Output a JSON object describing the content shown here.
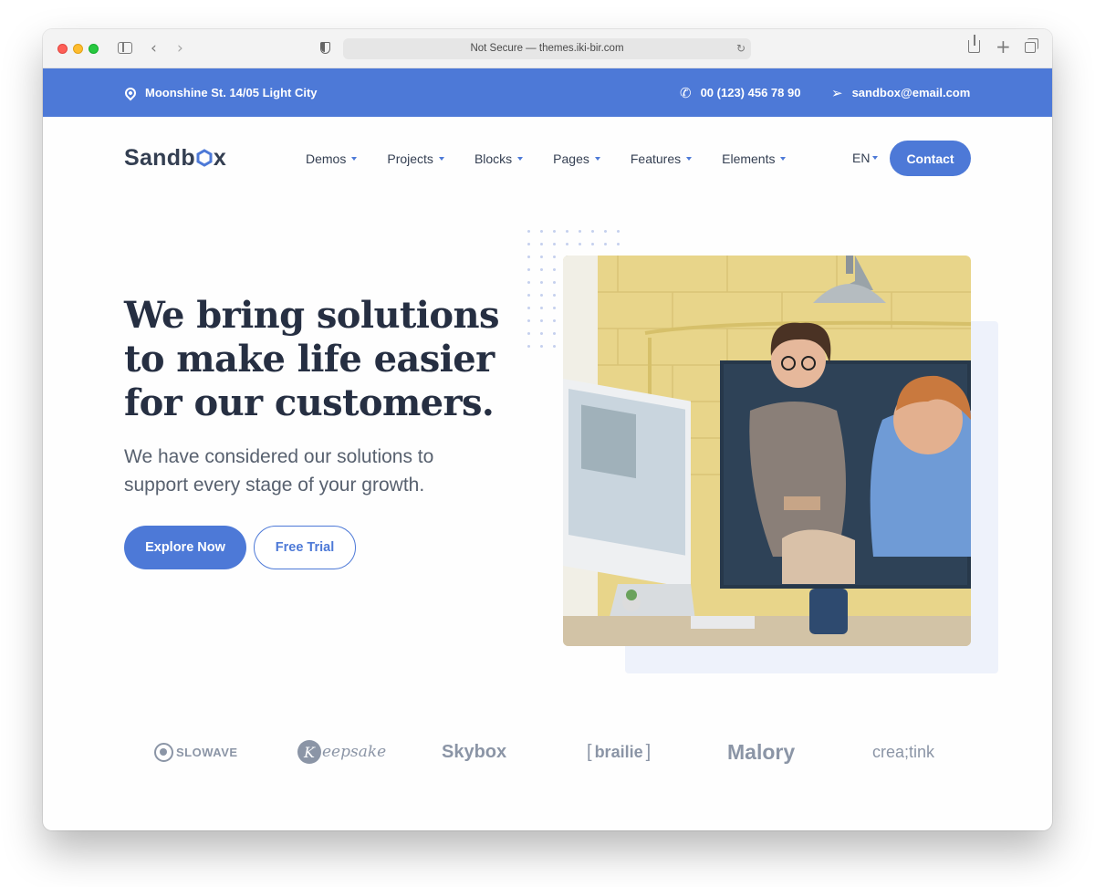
{
  "browser": {
    "url": "Not Secure — themes.iki-bir.com",
    "reload_icon": "reload-icon"
  },
  "topbar": {
    "address": "Moonshine St. 14/05 Light City",
    "phone": "00 (123) 456 78 90",
    "email": "sandbox@email.com",
    "background": "#4d79d7"
  },
  "header": {
    "logo": "Sandbox",
    "nav": [
      {
        "label": "Demos"
      },
      {
        "label": "Projects"
      },
      {
        "label": "Blocks"
      },
      {
        "label": "Pages"
      },
      {
        "label": "Features"
      },
      {
        "label": "Elements"
      }
    ],
    "language": "EN",
    "contact_label": "Contact"
  },
  "hero": {
    "title": "We bring solutions to make life easier for our customers.",
    "subtitle": "We have considered our solutions to support every stage of your growth.",
    "primary_button": "Explore Now",
    "secondary_button": "Free Trial"
  },
  "clients": [
    {
      "name": "SLOWAVE"
    },
    {
      "name": "eepsake",
      "mark": "K"
    },
    {
      "name": "Skybox"
    },
    {
      "name": "brailie"
    },
    {
      "name": "Malory"
    },
    {
      "name": "crea;tink"
    }
  ],
  "colors": {
    "accent": "#4d79d7",
    "heading": "#262f42",
    "body": "#58616f",
    "brand_gray": "#8b95a6"
  }
}
